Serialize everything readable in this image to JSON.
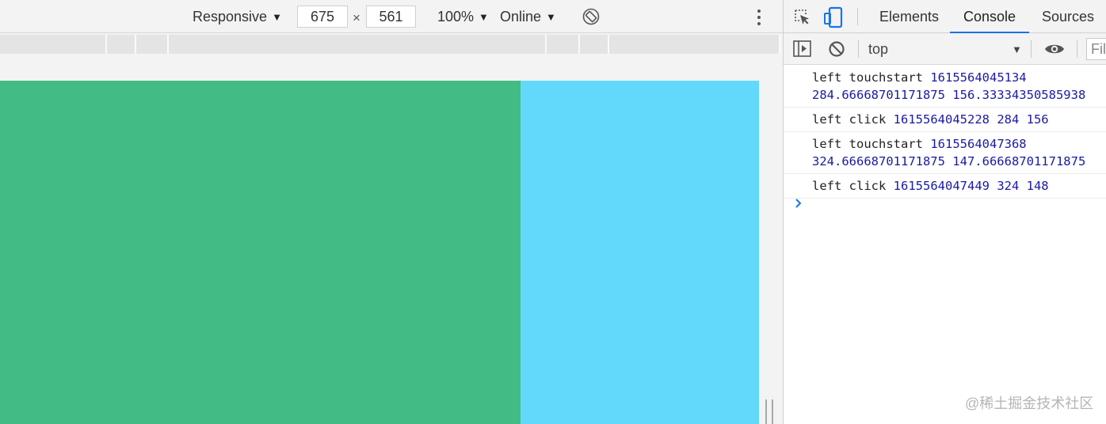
{
  "device_toolbar": {
    "device_label": "Responsive",
    "width_value": "675",
    "times_symbol": "×",
    "height_value": "561",
    "zoom_label": "100%",
    "throttle_label": "Online",
    "caret": "▼"
  },
  "viewport": {
    "left_box_color": "#43bb84",
    "right_box_color": "#62d9fb"
  },
  "devtools": {
    "tabs": [
      {
        "label": "Elements",
        "active": false
      },
      {
        "label": "Console",
        "active": true
      },
      {
        "label": "Sources",
        "active": false
      }
    ],
    "accent_color": "#1a73e8",
    "console_toolbar": {
      "context": "top",
      "caret": "▼",
      "filter_placeholder": "Filter"
    },
    "log": [
      {
        "text": "left touchstart",
        "nums": [
          "1615564045134",
          "284.66668701171875 156.33334350585938"
        ]
      },
      {
        "text": "left click",
        "nums": [
          "1615564045228 284 156"
        ]
      },
      {
        "text": "left touchstart",
        "nums": [
          "1615564047368",
          "324.66668701171875 147.66668701171875"
        ]
      },
      {
        "text": "left click",
        "nums": [
          "1615564047449 324 148"
        ]
      }
    ]
  },
  "watermark": "@稀土掘金技术社区"
}
